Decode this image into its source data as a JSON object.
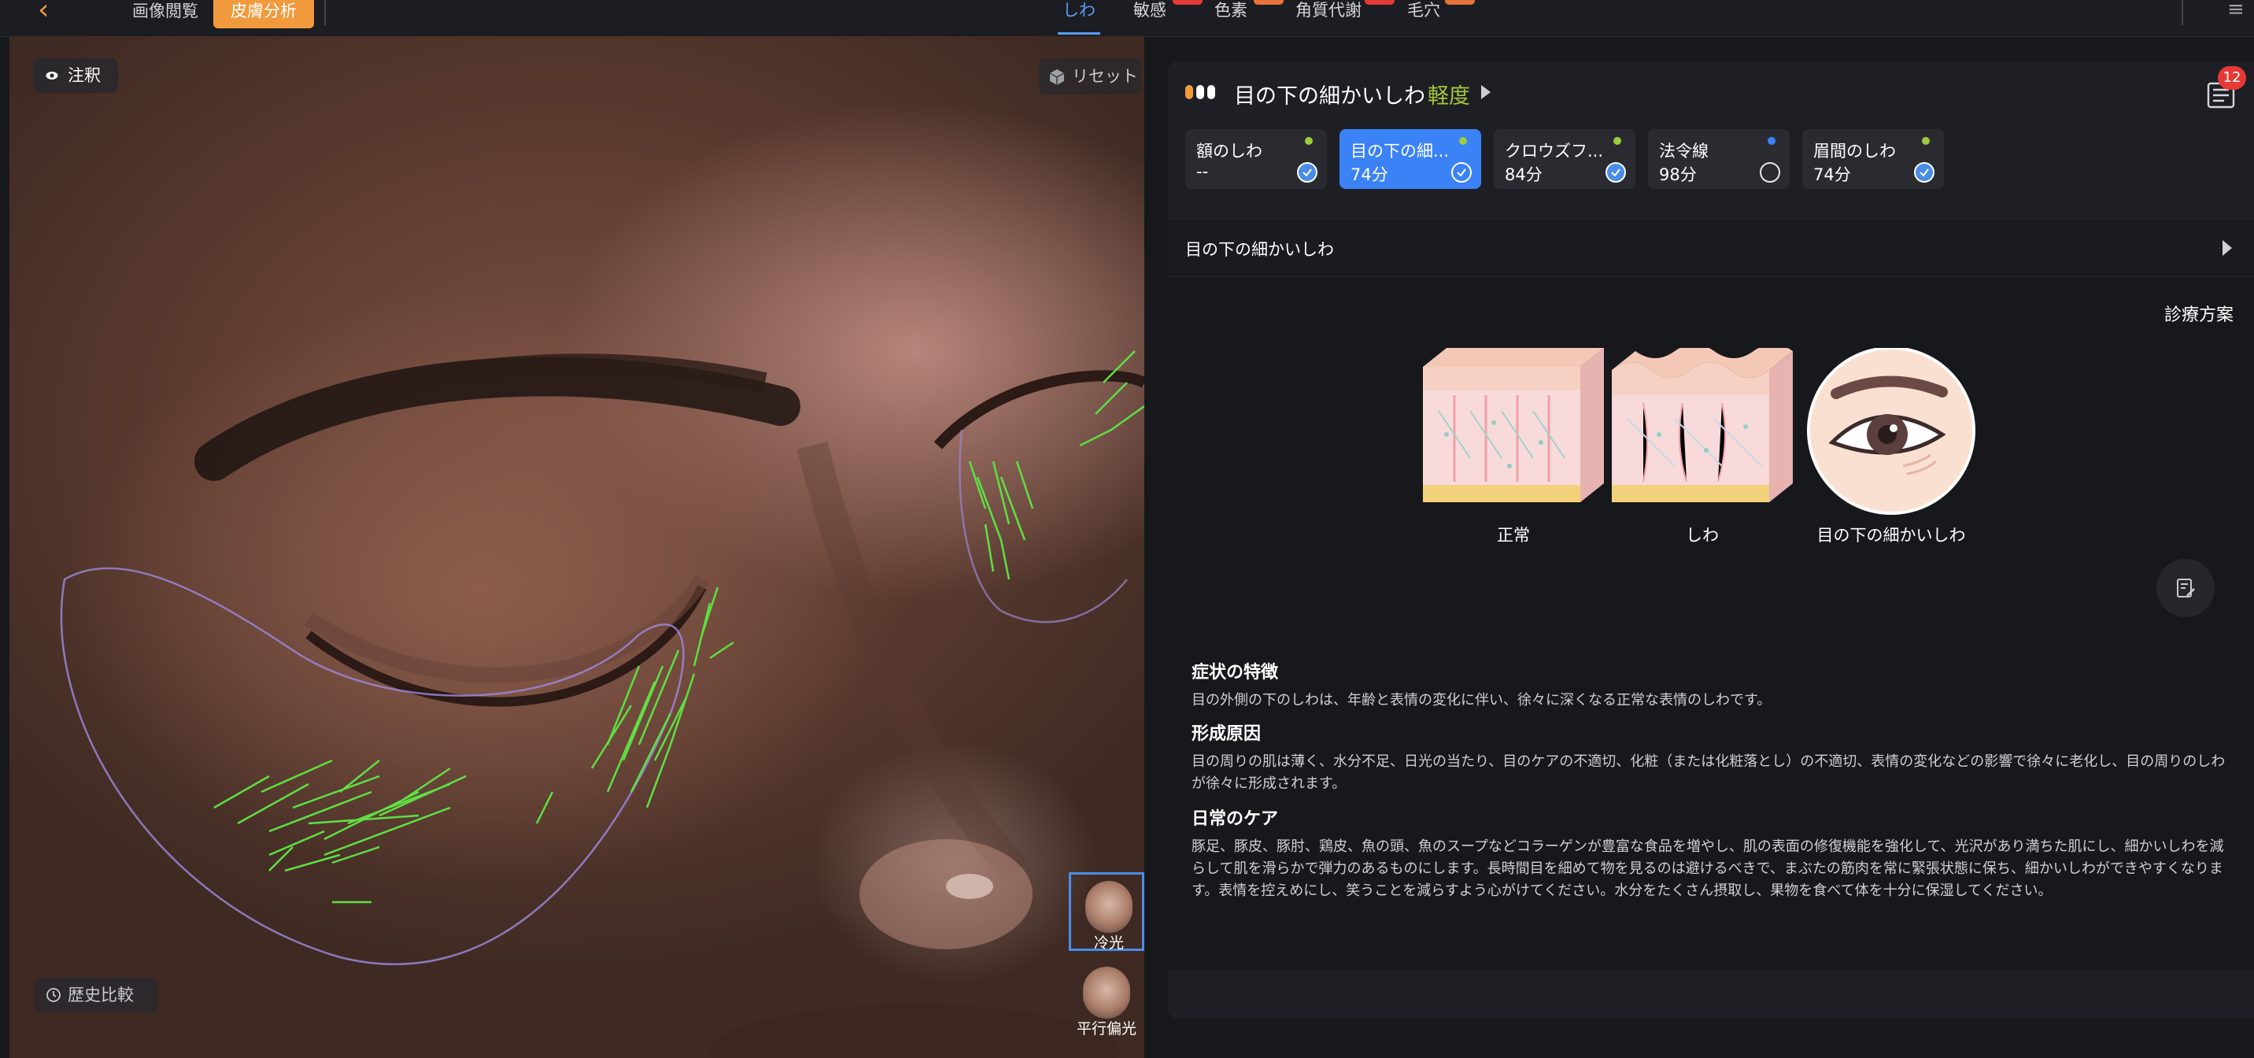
{
  "topbar": {
    "image_view_label": "画像閲覧",
    "skin_analysis_label": "皮膚分析",
    "categories": [
      "しわ",
      "敏感",
      "色素",
      "角質代謝",
      "毛穴"
    ],
    "active_category": "しわ"
  },
  "photo": {
    "annotation_label": "注釈",
    "reset_label": "リセット",
    "history_label": "歴史比較",
    "thumbs": [
      {
        "label": "冷光",
        "selected": true
      },
      {
        "label": "平行偏光",
        "selected": false
      }
    ]
  },
  "panel": {
    "title": "目の下の細かいしわ",
    "severity": "軽度",
    "report_badge": "12",
    "sub_tabs": [
      {
        "name": "額のしわ",
        "score": "--",
        "checked": true
      },
      {
        "name": "目の下の細...",
        "score": "74分",
        "checked": true,
        "active": true
      },
      {
        "name": "クロウズフ...",
        "score": "84分",
        "checked": true
      },
      {
        "name": "法令線",
        "score": "98分",
        "checked": false
      },
      {
        "name": "眉間のしわ",
        "score": "74分",
        "checked": true
      }
    ],
    "section_label": "目の下の細かいしわ",
    "plan_label": "診療方案",
    "illustrations": [
      {
        "caption": "正常",
        "icon": "normal-skin-illustration"
      },
      {
        "caption": "しわ",
        "icon": "wrinkled-skin-illustration"
      },
      {
        "caption": "目の下の細かいしわ",
        "icon": "eye-wrinkle-illustration"
      }
    ],
    "symptoms_title": "症状の特徴",
    "symptoms_text": "目の外側の下のしわは、年齢と表情の変化に伴い、徐々に深くなる正常な表情のしわです。",
    "cause_title": "形成原因",
    "cause_text": "目の周りの肌は薄く、水分不足、日光の当たり、目のケアの不適切、化粧（または化粧落とし）の不適切、表情の変化などの影響で徐々に老化し、目の周りのしわが徐々に形成されます。",
    "care_title": "日常のケア",
    "care_text": "豚足、豚皮、豚肘、鶏皮、魚の頭、魚のスープなどコラーゲンが豊富な食品を増やし、肌の表面の修復機能を強化して、光沢があり満ちた肌にし、細かいしわを減らして肌を滑らかで弾力のあるものにします。長時間目を細めて物を見るのは避けるべきで、まぶたの筋肉を常に緊張状態に保ち、細かいしわができやすくなります。表情を控えめにし、笑うことを減らすよう心がけてください。水分をたくさん摂取し、果物を食べて体を十分に保湿してください。"
  },
  "colors": {
    "accent_orange": "#f19a3d",
    "accent_blue": "#3b82f6",
    "severity_green": "#a4c639",
    "badge_red": "#e53935",
    "annotation_green": "#5ee043"
  }
}
